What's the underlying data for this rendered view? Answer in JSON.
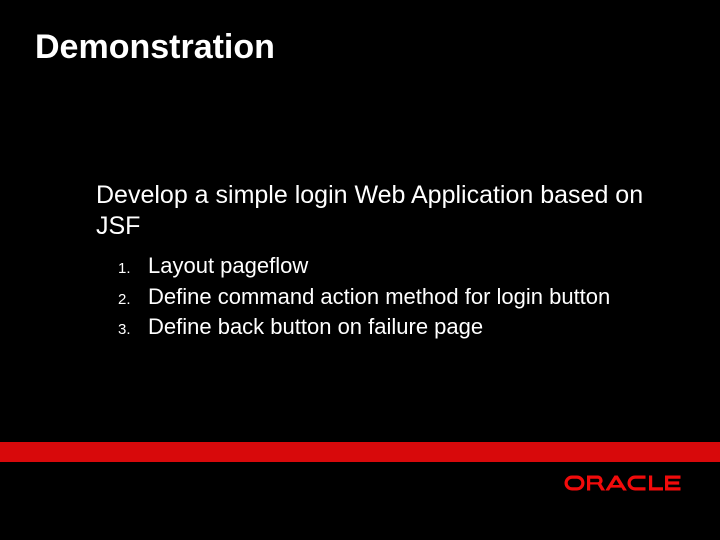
{
  "title": "Demonstration",
  "subtitle": "Develop a simple login Web Application based on JSF",
  "items": [
    {
      "num": "1.",
      "text": "Layout pageflow"
    },
    {
      "num": "2.",
      "text": "Define command action method for login button"
    },
    {
      "num": "3.",
      "text": "Define back button on failure page"
    }
  ],
  "brand": {
    "name": "ORACLE",
    "color": "#f20b0b"
  }
}
